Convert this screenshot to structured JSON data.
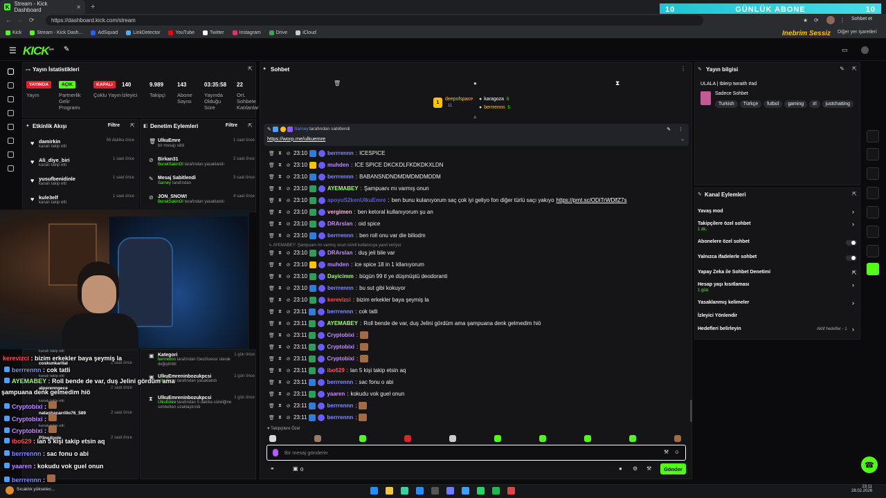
{
  "browser": {
    "tab_title": "Stream - Kick Dashboard",
    "url": "https://dashboard.kick.com/stream",
    "profile_button": "Sohbet et",
    "bookmarks": [
      "Kick",
      "Stream - Kick Dash...",
      "AdSquad",
      "LinkDetector",
      "YouTube",
      "Twitter",
      "Instagram",
      "Drive",
      "iCloud"
    ],
    "bookmark_colors": [
      "#53fc18",
      "#53fc18",
      "#2563eb",
      "#4cafef",
      "#ff0000",
      "#ffffff",
      "#e1306c",
      "#34a853",
      "#cccccc"
    ],
    "bookmarks_right": "Diğer yer işaretleri"
  },
  "overlay_banner": {
    "left": "10",
    "text": "GÜNLÜK ABONE",
    "right": "10"
  },
  "overlay_logo": "Inebrim Sessiz",
  "app": {
    "logo": "KICK",
    "logo_sup": "BETA"
  },
  "stats": {
    "title": "Yayın İstatistikleri",
    "items": [
      {
        "badge": "YAYINDA",
        "badge_color": "#e1222e",
        "label": "Yayın"
      },
      {
        "badge": "AÇIK",
        "badge_color": "#53fc18",
        "label": "Partnerlik Gelir Programı"
      },
      {
        "badge": "KAPALI",
        "badge_color": "#e1222e",
        "label": "Çoklu Yayın"
      },
      {
        "value": "140",
        "label": "İzleyici"
      },
      {
        "value": "9.989",
        "label": "Takipçi"
      },
      {
        "value": "143",
        "label": "Abone Sayısı"
      },
      {
        "value": "03:35:58",
        "label": "Yayında Olduğu Süre"
      },
      {
        "value": "22",
        "label": "Ort. Sohbete Katılanlar"
      }
    ]
  },
  "activity": {
    "title": "Etkinlik Akışı",
    "filter": "Filtre",
    "items": [
      {
        "name": "damirkin",
        "sub": "kanalı takip etti",
        "time": "56 dakika önce"
      },
      {
        "name": "Ali_diye_biri",
        "sub": "kanalı takip etti",
        "time": "1 saat önce"
      },
      {
        "name": "yusufbenidinle",
        "sub": "kanalı takip etti",
        "time": "1 saat önce"
      },
      {
        "name": "kule3elf",
        "sub": "kanalı takip etti",
        "time": "1 saat önce"
      }
    ],
    "lower_items": [
      {
        "name": "coskunkarital",
        "time": "2 saat önce"
      },
      {
        "name": "alperenngece",
        "time": "2 saat önce"
      },
      {
        "name": "natashacarrillo76_589",
        "time": "2 saat önce"
      },
      {
        "name": "P3ne4pple",
        "time": "2 saat önce"
      }
    ],
    "lower_sub": "kanalı takip etti"
  },
  "moderation": {
    "title": "Denetim Eylemleri",
    "filter": "Filtre",
    "items": [
      {
        "name": "UlkuEmre",
        "sub": "bir mesajı sildi",
        "time": "1 saat önce"
      },
      {
        "name": "Birkan31",
        "actor": "BurakSakinOl",
        "sub": "tarafından yasaklandı",
        "time": "2 saat önce"
      },
      {
        "name": "Mesaj Sabitlendi",
        "actor": "Sarney",
        "sub": "tarafından",
        "time": "3 saat önce"
      },
      {
        "name": "JON_SNOW!",
        "actor": "BurakSakinOl",
        "sub": "tarafından yasaklandı",
        "time": "4 saat önce"
      }
    ],
    "lower_items": [
      {
        "name": "Kategori",
        "actor": "berrrennn",
        "sub": "tarafından GeoGuessr olarak değiştirildi",
        "time": "1 gün önce"
      },
      {
        "name": "UlkuEmreninbozukpcsi",
        "actor": "UlkuEmre",
        "sub": "tarafından yasaklandı",
        "time": "1 gün önce"
      },
      {
        "name": "UlkuEmreninbozukpcsi",
        "actor": "UlkuEmre",
        "sub": "tarafından 5 dakika süreliğine sohbetten uzaklaştırıldı",
        "time": "1 gün önce"
      }
    ]
  },
  "chat": {
    "title": "Sohbet",
    "top_users": [
      {
        "name": "deepofspace",
        "count": "11"
      },
      {
        "name": "karagoza",
        "count": "5"
      },
      {
        "name": "berrrennn",
        "count": "5"
      }
    ],
    "pinned": {
      "by": "Sarney",
      "by_text": "tarafından sabitlendi",
      "link": "https://worp.me/ulkuemre"
    },
    "reply_context": "↳ AYEMABEY: Şampuanı mı varmış onun isimli kullanıcıya yanıt veriyor",
    "messages": [
      {
        "time": "23:10",
        "user": "berrrennn",
        "color": "#7f8cff",
        "text": "ICESPICE"
      },
      {
        "time": "23:10",
        "user": "muhden",
        "color": "#b98cff",
        "text": "ICE SPICE DKCKDLFKDKDKXLDN"
      },
      {
        "time": "23:10",
        "user": "berrrennn",
        "color": "#7f8cff",
        "text": "BABANSNDNDMDMDMDMDDM"
      },
      {
        "time": "23:10",
        "user": "AYEMABEY",
        "color": "#9bff6a",
        "text": "Şampuanı mı varmış onun"
      },
      {
        "time": "23:10",
        "user": "apoyuS2kenUlkuEmre",
        "color": "#5b5bd6",
        "text": "ben bunu kulanıyorum saç çok iyi geliyo fon diğer türlü saçı yakıyo",
        "link": "https://prnt.sc/ODiTrWDlfZ7s"
      },
      {
        "time": "23:10",
        "user": "vergimen",
        "color": "#ffb3d9",
        "text": "ben ketoral kullanıyorum şu an"
      },
      {
        "time": "23:10",
        "user": "DRArslan",
        "color": "#c58cff",
        "text": "oid spice"
      },
      {
        "time": "23:10",
        "user": "berrrennn",
        "color": "#7f8cff",
        "text": "ben roll onu var die biliodm"
      },
      {
        "time": "23:10",
        "user": "DRArslan",
        "color": "#c58cff",
        "text": "duş jeli bile var"
      },
      {
        "time": "23:10",
        "user": "muhden",
        "color": "#b98cff",
        "text": "ice spice 18 in 1 kllanıyorum"
      },
      {
        "time": "23:10",
        "user": "Dayicimm",
        "color": "#9bff6a",
        "text": "bügün 99 tl ye düşmüştü deodoranti"
      },
      {
        "time": "23:10",
        "user": "berrrennn",
        "color": "#7f8cff",
        "text": "bu sut gibi kokuyor"
      },
      {
        "time": "23:10",
        "user": "kerevizci",
        "color": "#ff4d4d",
        "text": "bizim erkekler baya şeymiş la"
      },
      {
        "time": "23:11",
        "user": "berrrennn",
        "color": "#7f8cff",
        "text": "cok tatli"
      },
      {
        "time": "23:11",
        "user": "AYEMABEY",
        "color": "#9bff6a",
        "text": "Roll bende de var, duş Jelini gördüm ama şampuana denk gelmedim hiö"
      },
      {
        "time": "23:11",
        "user": "Cryptobixi",
        "color": "#c58cff",
        "text": ""
      },
      {
        "time": "23:11",
        "user": "Cryptobixi",
        "color": "#c58cff",
        "text": ""
      },
      {
        "time": "23:11",
        "user": "Cryptobixi",
        "color": "#c58cff",
        "text": ""
      },
      {
        "time": "23:11",
        "user": "ibo629",
        "color": "#ff4d4d",
        "text": "lan 5 kişi takip etsin aq"
      },
      {
        "time": "23:11",
        "user": "berrrennn",
        "color": "#7f8cff",
        "text": "sac fonu o abi"
      },
      {
        "time": "23:11",
        "user": "yaaren",
        "color": "#c58cff",
        "text": "kokudu vok guel onun"
      },
      {
        "time": "23:11",
        "user": "berrrennn",
        "color": "#7f8cff",
        "text": ""
      },
      {
        "time": "23:11",
        "user": "berrrennn",
        "color": "#7f8cff",
        "text": ""
      }
    ],
    "follower_label": "Takipçilere Özel",
    "input_placeholder": "Bir mesaj gönderin",
    "points": "0",
    "send": "Gönder"
  },
  "stream_info": {
    "title": "Yayın bilgisi",
    "stream_title": "ULALA | tblerp twraith #ad",
    "category": "Sadece Sohbet",
    "tags": [
      "Turkish",
      "Türkçe",
      "futbol",
      "gaming",
      "irl",
      "justchatting"
    ]
  },
  "channel_actions": {
    "title": "Kanal Eylemleri",
    "items": [
      {
        "label": "Yavaş mod",
        "type": "arrow"
      },
      {
        "label": "Takipçilere özel sohbet",
        "sub": "1 dk.",
        "type": "arrow"
      },
      {
        "label": "Abonelere özel sohbet",
        "type": "toggle"
      },
      {
        "label": "Yalnızca ifadelerle sohbet",
        "type": "toggle"
      },
      {
        "label": "Yapay Zeka ile Sohbet Denetimi",
        "type": "ext"
      },
      {
        "label": "Hesap yaşı kısıtlaması",
        "sub": "1 gün",
        "type": "arrow"
      },
      {
        "label": "Yasaklanmış kelimeler",
        "type": "arrow"
      },
      {
        "label": "İzleyici Yönlendir",
        "type": "none"
      },
      {
        "label": "Hedefleri belirleyin",
        "note": "Aktif hedefler - 1",
        "type": "arrow"
      }
    ]
  },
  "stream_overlay": [
    {
      "user": "kerevizci",
      "color": "#ff4d4d",
      "text": "bizim erkekler baya şeymiş la"
    },
    {
      "user": "berrrennn",
      "color": "#7f8cff",
      "text": "cok tatli"
    },
    {
      "user": "AYEMABEY",
      "color": "#9bff6a",
      "text": "Roll bende de var, duş Jelini gördüm ama"
    },
    {
      "user": "",
      "color": "#ffffff",
      "text": "şampuana denk gelmedim hiö"
    },
    {
      "user": "Cryptobixi",
      "color": "#c58cff",
      "text": ""
    },
    {
      "user": "Cryptobixi",
      "color": "#c58cff",
      "text": ""
    },
    {
      "user": "Cryptobixi",
      "color": "#c58cff",
      "text": ""
    },
    {
      "user": "ibo629",
      "color": "#ff4d4d",
      "text": "lan 5 kişi takip etsin aq"
    },
    {
      "user": "berrrennn",
      "color": "#7f8cff",
      "text": "sac fonu o abi"
    },
    {
      "user": "yaaren",
      "color": "#c58cff",
      "text": "kokudu vok guel onun"
    },
    {
      "user": "berrrennn",
      "color": "#7f8cff",
      "text": ""
    },
    {
      "user": "berrrennn",
      "color": "#7f8cff",
      "text": ""
    }
  ],
  "taskbar": {
    "weather": "Sıcaklık yükselec...",
    "time": "23:11",
    "date": "28.02.2026"
  }
}
